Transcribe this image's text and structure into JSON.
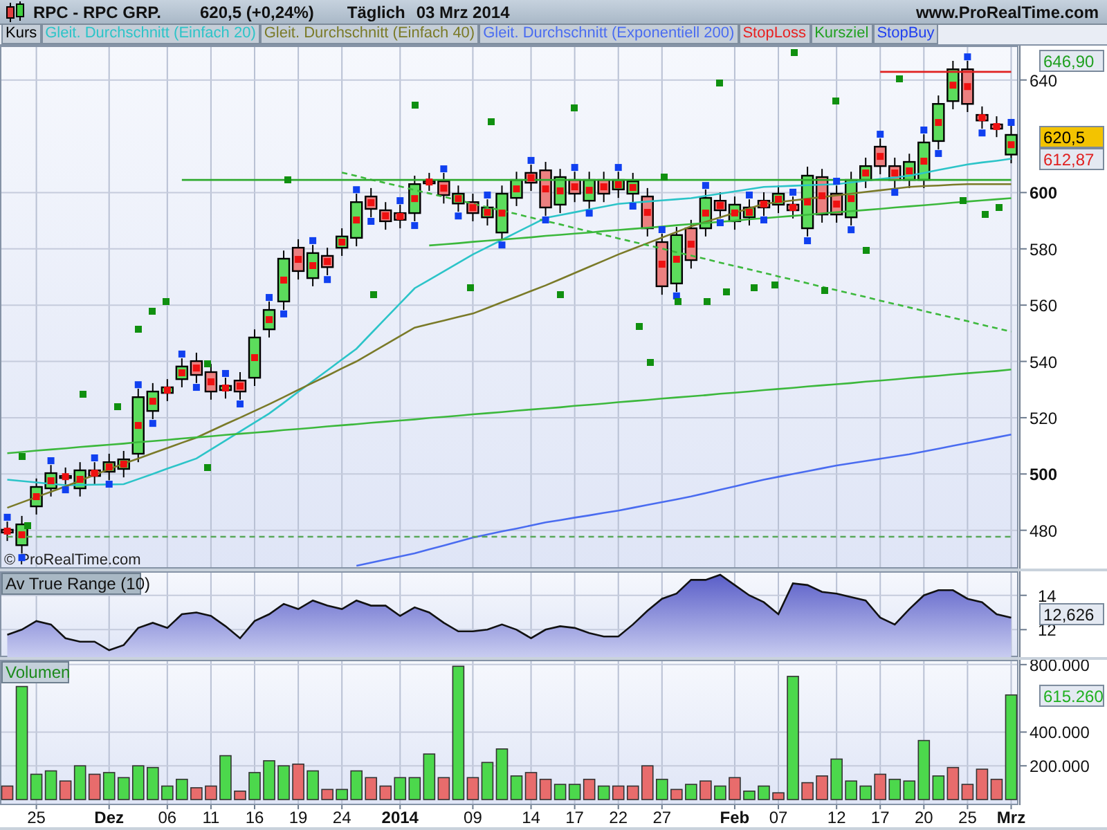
{
  "header": {
    "symbol": "RPC - RPC GRP.",
    "price": "620,5 (+0,24%)",
    "period": "Täglich",
    "date": "03 Mrz 2014",
    "website": "www.ProRealTime.com"
  },
  "legend": [
    {
      "label": "Kurs",
      "color": "#000000"
    },
    {
      "label": "Gleit. Durchschnitt (Einfach 20)",
      "color": "#2cc4c8"
    },
    {
      "label": "Gleit. Durchschnitt (Einfach 40)",
      "color": "#7a7a28"
    },
    {
      "label": "Gleit. Durchschnitt (Exponentiell 200)",
      "color": "#4a6cf0"
    },
    {
      "label": "StopLoss",
      "color": "#e82020"
    },
    {
      "label": "Kursziel",
      "color": "#20a020"
    },
    {
      "label": "StopBuy",
      "color": "#2040f0"
    }
  ],
  "price_panel": {
    "chart_data": {
      "type": "candlestick",
      "ylim": [
        466.4,
        652.2
      ],
      "grid": true,
      "yticks": [
        {
          "value": 640,
          "label": "640"
        },
        {
          "value": 600,
          "label": "600"
        },
        {
          "value": 580,
          "label": "580"
        },
        {
          "value": 560,
          "label": "560"
        },
        {
          "value": 540,
          "label": "540"
        },
        {
          "value": 520,
          "label": "520"
        },
        {
          "value": 500,
          "label": "500"
        },
        {
          "value": 480,
          "label": "480"
        }
      ],
      "ohlc": [
        [
          480.2,
          483.1,
          476.2,
          479.2
        ],
        [
          474.7,
          485.1,
          471.8,
          482.1
        ],
        [
          488.5,
          498.4,
          485.6,
          495.4
        ],
        [
          494.9,
          503.2,
          492,
          500.3
        ],
        [
          498.8,
          502.3,
          495.9,
          499.3
        ],
        [
          494.9,
          504.2,
          492,
          501.3
        ],
        [
          501.3,
          504.2,
          496.4,
          499.3
        ],
        [
          500.8,
          507.2,
          497.8,
          504.2
        ],
        [
          501.8,
          508.2,
          498.8,
          505.2
        ],
        [
          507.2,
          530.3,
          504.2,
          527.3
        ],
        [
          522.4,
          532.3,
          519.5,
          529.3
        ],
        [
          528.8,
          533.7,
          525.9,
          530.8
        ],
        [
          533.7,
          541.1,
          530.8,
          538.2
        ],
        [
          540.1,
          543.1,
          532.3,
          535.2
        ],
        [
          536.2,
          539.1,
          526.4,
          529.3
        ],
        [
          529.8,
          534.2,
          526.8,
          531.3
        ],
        [
          533.2,
          536.2,
          526.4,
          529.3
        ],
        [
          534.2,
          551.4,
          531.3,
          548.5
        ],
        [
          551.4,
          561.3,
          548.5,
          558.3
        ],
        [
          561.3,
          579.4,
          558.3,
          576.5
        ],
        [
          580.4,
          583.4,
          569.1,
          572.1
        ],
        [
          569.6,
          581.4,
          566.7,
          578.5
        ],
        [
          577.5,
          580.4,
          570.6,
          573.5
        ],
        [
          580.4,
          587.3,
          577.5,
          584.4
        ],
        [
          583.9,
          599.6,
          580.9,
          596.6
        ],
        [
          598.6,
          601.6,
          591.2,
          594.2
        ],
        [
          593.7,
          596.6,
          586.8,
          589.8
        ],
        [
          592.7,
          595.7,
          587.3,
          590.3
        ],
        [
          592.7,
          606,
          589.8,
          603
        ],
        [
          604,
          607,
          600.6,
          603.5
        ],
        [
          604,
          607,
          596.1,
          599.1
        ],
        [
          596.1,
          602.5,
          593.2,
          599.6
        ],
        [
          596.6,
          599.6,
          589.8,
          592.7
        ],
        [
          591.2,
          597.6,
          588.3,
          594.7
        ],
        [
          585.8,
          602.5,
          582.9,
          599.6
        ],
        [
          598.1,
          607.4,
          595.2,
          604.5
        ],
        [
          607,
          609.9,
          600.6,
          603.5
        ],
        [
          607.9,
          610.9,
          591.7,
          594.7
        ],
        [
          595.7,
          608.4,
          592.7,
          605.5
        ],
        [
          604.5,
          607.4,
          596.6,
          599.6
        ],
        [
          597.1,
          607.4,
          594.2,
          604.5
        ],
        [
          604.5,
          607.4,
          596.6,
          599.6
        ],
        [
          601.1,
          607.4,
          598.1,
          604.5
        ],
        [
          599.6,
          607,
          596.6,
          604
        ],
        [
          598.6,
          601.6,
          584.4,
          587.3
        ],
        [
          582.4,
          585.4,
          563.7,
          566.7
        ],
        [
          567.7,
          587.8,
          564.7,
          584.9
        ],
        [
          587.3,
          590.3,
          573,
          576
        ],
        [
          587.3,
          601.1,
          584.4,
          598.1
        ],
        [
          597.1,
          600.1,
          590.8,
          593.7
        ],
        [
          589.8,
          598.6,
          586.8,
          595.7
        ],
        [
          591.2,
          597.6,
          588.3,
          594.7
        ],
        [
          597.1,
          600.1,
          591.7,
          594.7
        ],
        [
          595.7,
          602.5,
          592.7,
          599.6
        ],
        [
          595.7,
          598.6,
          590.8,
          593.7
        ],
        [
          587.3,
          609.2,
          584.4,
          606
        ],
        [
          605.5,
          608.4,
          589.3,
          592.2
        ],
        [
          599.6,
          602.5,
          589.3,
          592.2
        ],
        [
          591.2,
          607.4,
          588.3,
          604.5
        ],
        [
          604.5,
          612.4,
          601.6,
          609.4
        ],
        [
          616.3,
          619.2,
          606.5,
          609.4
        ],
        [
          609.4,
          612.4,
          601.6,
          604.5
        ],
        [
          604.5,
          613.8,
          601.6,
          610.9
        ],
        [
          604.5,
          620.7,
          601.6,
          617.8
        ],
        [
          618.3,
          634.5,
          615.3,
          631.5
        ],
        [
          632.5,
          646.8,
          629.6,
          643.8
        ],
        [
          643.8,
          646.8,
          628.6,
          631.5
        ],
        [
          627.6,
          630.6,
          622.7,
          625.6
        ],
        [
          624.2,
          627.1,
          619.7,
          622.7
        ],
        [
          613.5,
          624.2,
          610.4,
          620.5
        ]
      ]
    },
    "indicators": {
      "chart_data": {
        "type": "line",
        "ylim": [
          466.4,
          652.2
        ],
        "series": [
          {
            "color": "#2cc4c8",
            "values": [
              498,
              497.5,
              497,
              496.5,
              496,
              496.1,
              496.2,
              496.3,
              496.4,
              498.2,
              500,
              501.9,
              503.7,
              505.5,
              508.7,
              511.9,
              515.1,
              518.3,
              521.5,
              525.3,
              529.2,
              533,
              536.8,
              540.7,
              544.5,
              549.9,
              555.3,
              560.6,
              566,
              569,
              572,
              575,
              578,
              580.6,
              583.2,
              585.8,
              588.4,
              591,
              592,
              593,
              594,
              595,
              596,
              596.4,
              596.8,
              597.2,
              597.6,
              598,
              598.8,
              599.6,
              600.4,
              601.2,
              602,
              602.2,
              602.4,
              602.6,
              602.8,
              603,
              603.6,
              604.2,
              604.8,
              605.4,
              606,
              607,
              608,
              609,
              610,
              610.7,
              611.3,
              612
            ]
          },
          {
            "color": "#7a7a28",
            "values": [
              488,
              489.9,
              491.8,
              493.7,
              495.6,
              497.6,
              499.7,
              501.7,
              503.7,
              505.5,
              507.4,
              509.2,
              511.1,
              512.9,
              515.3,
              517.7,
              520,
              522.4,
              524.8,
              527.3,
              529.9,
              532.4,
              534.9,
              537.5,
              540,
              543,
              546,
              549,
              552,
              553.3,
              554.5,
              555.8,
              557,
              559,
              561,
              563,
              565,
              567,
              569.2,
              571.4,
              573.6,
              575.8,
              578,
              580,
              582,
              584,
              586,
              588,
              589.6,
              591.2,
              592.8,
              594.4,
              596,
              596.6,
              597.2,
              597.8,
              598.4,
              599,
              599.6,
              600.2,
              600.8,
              601.4,
              602,
              602.3,
              602.5,
              602.8,
              603,
              603,
              603,
              603
            ]
          },
          {
            "color": "#4a6cf0",
            "values": [
              null,
              null,
              null,
              null,
              null,
              null,
              null,
              null,
              null,
              null,
              null,
              null,
              null,
              null,
              null,
              null,
              null,
              null,
              null,
              null,
              null,
              null,
              null,
              null,
              467.4,
              468.5,
              469.6,
              470.7,
              471.8,
              473.2,
              474.6,
              476,
              477.4,
              478.5,
              479.6,
              480.6,
              481.7,
              482.8,
              483.6,
              484.5,
              485.3,
              486.2,
              487,
              488,
              489,
              490,
              491,
              492,
              493.2,
              494.4,
              495.6,
              496.8,
              498,
              499,
              500,
              501,
              502,
              503,
              503.8,
              504.6,
              505.4,
              506.2,
              507,
              508,
              509,
              510,
              511,
              512,
              513,
              514
            ]
          },
          {
            "color": "#3cb83c",
            "values": [
              507.4,
              507.8,
              508.3,
              508.7,
              509.1,
              509.6,
              510,
              510.4,
              510.8,
              511.3,
              511.7,
              512.1,
              512.6,
              513,
              513.4,
              513.9,
              514.3,
              514.7,
              515.1,
              515.6,
              516,
              516.4,
              516.9,
              517.3,
              517.7,
              518.2,
              518.6,
              519,
              519.4,
              519.9,
              520.3,
              520.7,
              521.2,
              521.6,
              522,
              522.5,
              522.9,
              523.3,
              523.7,
              524.2,
              524.6,
              525,
              525.5,
              525.9,
              526.3,
              526.8,
              527.2,
              527.6,
              528,
              528.5,
              528.9,
              529.3,
              529.8,
              530.2,
              530.6,
              531.1,
              531.5,
              531.9,
              532.3,
              532.8,
              533.2,
              533.6,
              534.1,
              534.5,
              534.9,
              535.4,
              535.8,
              536.2,
              536.6,
              537.1
            ]
          },
          {
            "color": "#3cb83c",
            "values": [
              null,
              null,
              null,
              null,
              null,
              null,
              null,
              null,
              null,
              null,
              null,
              null,
              null,
              null,
              null,
              null,
              null,
              null,
              null,
              null,
              null,
              null,
              null,
              null,
              null,
              null,
              null,
              null,
              null,
              581.2,
              581.6,
              582,
              582.5,
              582.9,
              583.3,
              583.7,
              584.1,
              584.6,
              585,
              585.4,
              585.8,
              586.3,
              586.7,
              587.1,
              587.5,
              587.9,
              588.4,
              588.8,
              589.2,
              589.6,
              590,
              590.5,
              590.9,
              591.3,
              591.7,
              592.1,
              592.6,
              593,
              593.4,
              593.8,
              594.2,
              594.7,
              595.1,
              595.5,
              595.9,
              596.4,
              596.8,
              597.2,
              597.6,
              598.0
            ]
          },
          {
            "color": "#3cb83c",
            "line_style": "dashed",
            "values": [
              null,
              null,
              null,
              null,
              null,
              null,
              null,
              null,
              null,
              null,
              null,
              null,
              null,
              null,
              null,
              null,
              null,
              null,
              null,
              null,
              null,
              null,
              null,
              607.1,
              605.9,
              604.6,
              603.4,
              602.2,
              600.9,
              599.7,
              598.5,
              597.3,
              596,
              594.8,
              593.6,
              592.4,
              591.1,
              589.9,
              588.7,
              587.4,
              586.2,
              585,
              583.7,
              582.5,
              581.3,
              580.1,
              578.8,
              577.6,
              576.4,
              575.1,
              573.9,
              572.7,
              571.5,
              570.2,
              569,
              567.8,
              566.5,
              565.3,
              564.1,
              562.9,
              561.6,
              560.4,
              559.2,
              557.9,
              556.7,
              555.5,
              554.3,
              553,
              551.8,
              550.6
            ]
          },
          {
            "color": "#2faa2f",
            "values": [
              null,
              null,
              null,
              null,
              null,
              null,
              null,
              null,
              null,
              null,
              null,
              null,
              604.5,
              604.5,
              604.5,
              604.5,
              604.5,
              604.5,
              604.5,
              604.5,
              604.5,
              604.5,
              604.5,
              604.5,
              604.5,
              604.5,
              604.5,
              604.5,
              604.5,
              604.5,
              604.5,
              604.5,
              604.5,
              604.5,
              604.5,
              604.5,
              604.5,
              604.5,
              604.5,
              604.5,
              604.5,
              604.5,
              604.5,
              604.5,
              604.5,
              604.5,
              604.5,
              604.5,
              604.5,
              604.5,
              604.5,
              604.5,
              604.5,
              604.5,
              604.5,
              604.5,
              604.5,
              604.5,
              604.5,
              604.5,
              604.5,
              604.5,
              604.5,
              604.5,
              604.5,
              604.5,
              604.5,
              604.5,
              604.5,
              604.5
            ]
          },
          {
            "color": "#5aa85a",
            "line_style": "dashed",
            "values": [
              477.7,
              477.7,
              477.7,
              477.7,
              477.7,
              477.7,
              477.7,
              477.7,
              477.7,
              477.7,
              477.7,
              477.7,
              477.7,
              477.7,
              477.7,
              477.7,
              477.7,
              477.7,
              477.7,
              477.7,
              477.7,
              477.7,
              477.7,
              477.7,
              477.7,
              477.7,
              477.7,
              477.7,
              477.7,
              477.7,
              477.7,
              477.7,
              477.7,
              477.7,
              477.7,
              477.7,
              477.7,
              477.7,
              477.7,
              477.7,
              477.7,
              477.7,
              477.7,
              477.7,
              477.7,
              477.7,
              477.7,
              477.7,
              477.7,
              477.7,
              477.7,
              477.7,
              477.7,
              477.7,
              477.7,
              477.7,
              477.7,
              477.7,
              477.7,
              477.7,
              477.7,
              477.7,
              477.7,
              477.7,
              477.7,
              477.7,
              477.7,
              477.7,
              477.7,
              477.7
            ]
          },
          {
            "color": "#e02020",
            "values": [
              null,
              null,
              null,
              null,
              null,
              null,
              null,
              null,
              null,
              null,
              null,
              null,
              null,
              null,
              null,
              null,
              null,
              null,
              null,
              null,
              null,
              null,
              null,
              null,
              null,
              null,
              null,
              null,
              null,
              null,
              null,
              null,
              null,
              null,
              null,
              null,
              null,
              null,
              null,
              null,
              null,
              null,
              null,
              null,
              null,
              null,
              null,
              null,
              null,
              null,
              null,
              null,
              null,
              null,
              null,
              null,
              null,
              null,
              null,
              null,
              642.9,
              642.9,
              642.9,
              642.9,
              642.9,
              642.9,
              642.9,
              642.9,
              642.9,
              642.9
            ]
          }
        ]
      }
    },
    "value_tags": [
      {
        "kind": "target",
        "text": "646,90"
      },
      {
        "kind": "price",
        "text": "620,5"
      },
      {
        "kind": "stoploss",
        "text": "612,87"
      }
    ],
    "copyright": "© ProRealTime.com"
  },
  "atr_panel": {
    "last_value": "12,626",
    "chart_data": {
      "type": "area",
      "title": "Av True Range (10)",
      "ylim": [
        10.4,
        15.4
      ],
      "yticks": [
        12,
        14
      ],
      "grid": true,
      "series": [
        {
          "color": "#5a5ec8",
          "values": [
            11.7,
            12.0,
            12.5,
            12.3,
            11.5,
            11.3,
            11.3,
            10.8,
            11.1,
            12.1,
            12.4,
            12.1,
            12.9,
            13.0,
            12.8,
            12.2,
            11.5,
            12.5,
            12.9,
            13.5,
            13.2,
            13.7,
            13.4,
            13.2,
            13.7,
            13.4,
            13.4,
            12.8,
            13.3,
            13.0,
            12.4,
            11.9,
            11.9,
            12.0,
            12.3,
            12.0,
            11.5,
            12.0,
            12.2,
            12.1,
            11.8,
            11.6,
            11.6,
            12.3,
            13.1,
            13.8,
            14.1,
            14.9,
            14.9,
            15.2,
            14.6,
            14.0,
            13.6,
            12.9,
            14.7,
            14.6,
            14.2,
            14.1,
            13.9,
            13.7,
            12.7,
            12.3,
            13.2,
            14.0,
            14.3,
            14.3,
            13.8,
            13.6,
            12.9,
            12.7
          ]
        }
      ]
    }
  },
  "volume_panel": {
    "last_value": "615.260",
    "chart_data": {
      "type": "bar",
      "title": "Volumen",
      "stacked": true,
      "grid": true,
      "ylim": [
        0,
        828000
      ],
      "yticks": [
        {
          "value": 200000,
          "label": "200.000"
        },
        {
          "value": 400000,
          "label": "400.000"
        },
        {
          "value": 800000,
          "label": "800.000"
        }
      ],
      "series": [
        {
          "color": "#4cd84c",
          "values": [
            null,
            670000,
            150000,
            170000,
            null,
            200000,
            null,
            160000,
            130000,
            200000,
            190000,
            80000,
            120000,
            null,
            null,
            260000,
            null,
            160000,
            230000,
            200000,
            null,
            170000,
            null,
            60000,
            170000,
            null,
            null,
            130000,
            130000,
            270000,
            null,
            790000,
            null,
            220000,
            300000,
            140000,
            null,
            null,
            90000,
            90000,
            null,
            80000,
            null,
            null,
            null,
            120000,
            null,
            90000,
            null,
            80000,
            null,
            50000,
            80000,
            null,
            730000,
            null,
            null,
            240000,
            110000,
            80000,
            null,
            120000,
            110000,
            350000,
            140000,
            null,
            null,
            null,
            null,
            620000
          ]
        },
        {
          "color": "#e86c6c",
          "values": [
            80000,
            null,
            null,
            null,
            110000,
            null,
            150000,
            null,
            null,
            null,
            null,
            null,
            null,
            70000,
            80000,
            null,
            50000,
            null,
            null,
            null,
            210000,
            null,
            60000,
            null,
            null,
            130000,
            80000,
            null,
            null,
            null,
            130000,
            null,
            130000,
            null,
            null,
            null,
            160000,
            120000,
            null,
            null,
            120000,
            null,
            80000,
            80000,
            200000,
            null,
            60000,
            null,
            110000,
            null,
            130000,
            null,
            null,
            40000,
            null,
            100000,
            140000,
            null,
            null,
            null,
            150000,
            null,
            null,
            null,
            null,
            190000,
            90000,
            180000,
            120000,
            null
          ]
        }
      ]
    }
  },
  "x_axis": [
    {
      "label": "25",
      "bold": false
    },
    {
      "label": "Dez",
      "bold": true
    },
    {
      "label": "06",
      "bold": false
    },
    {
      "label": "11",
      "bold": false
    },
    {
      "label": "16",
      "bold": false
    },
    {
      "label": "19",
      "bold": false
    },
    {
      "label": "24",
      "bold": false
    },
    {
      "label": "2014",
      "bold": true
    },
    {
      "label": "09",
      "bold": false
    },
    {
      "label": "14",
      "bold": false
    },
    {
      "label": "17",
      "bold": false
    },
    {
      "label": "22",
      "bold": false
    },
    {
      "label": "27",
      "bold": false
    },
    {
      "label": "Feb",
      "bold": true
    },
    {
      "label": "07",
      "bold": false
    },
    {
      "label": "12",
      "bold": false
    },
    {
      "label": "17",
      "bold": false
    },
    {
      "label": "20",
      "bold": false
    },
    {
      "label": "25",
      "bold": false
    },
    {
      "label": "Mrz",
      "bold": true
    }
  ]
}
